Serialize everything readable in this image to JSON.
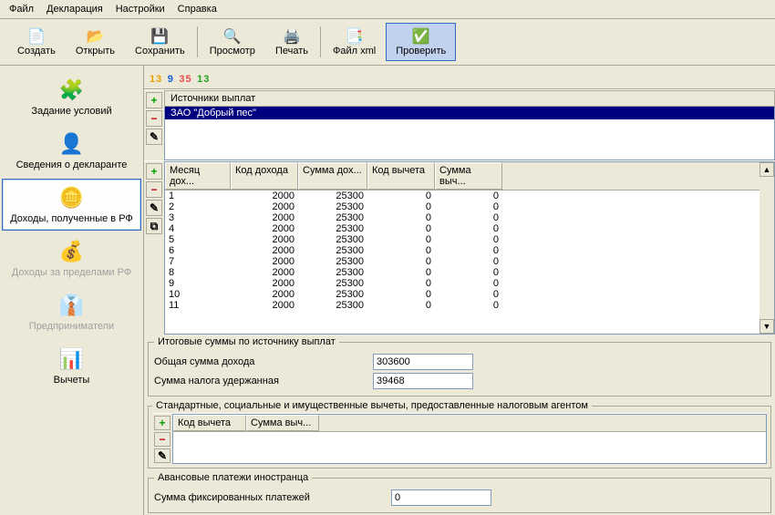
{
  "menu": {
    "file": "Файл",
    "decl": "Декларация",
    "settings": "Настройки",
    "help": "Справка"
  },
  "toolbar": {
    "create": "Создать",
    "open": "Открыть",
    "save": "Сохранить",
    "preview": "Просмотр",
    "print": "Печать",
    "xml": "Файл xml",
    "check": "Проверить"
  },
  "year": {
    "a": "13",
    "b": "9",
    "c": "35",
    "d": "13"
  },
  "sidebar": {
    "cond": "Задание условий",
    "declarant": "Сведения о декларанте",
    "incomeRf": "Доходы, полученные в РФ",
    "incomeAbroad": "Доходы за пределами РФ",
    "entrepreneur": "Предприниматели",
    "deductions": "Вычеты"
  },
  "sources": {
    "header": "Источники выплат",
    "items": [
      "ЗАО \"Добрый пес\""
    ]
  },
  "incomeTable": {
    "cols": [
      "Месяц дох...",
      "Код дохода",
      "Сумма дох...",
      "Код вычета",
      "Сумма выч..."
    ],
    "rows": [
      {
        "m": "1",
        "code": "2000",
        "sum": "25300",
        "dcode": "0",
        "dsum": "0"
      },
      {
        "m": "2",
        "code": "2000",
        "sum": "25300",
        "dcode": "0",
        "dsum": "0"
      },
      {
        "m": "3",
        "code": "2000",
        "sum": "25300",
        "dcode": "0",
        "dsum": "0"
      },
      {
        "m": "4",
        "code": "2000",
        "sum": "25300",
        "dcode": "0",
        "dsum": "0"
      },
      {
        "m": "5",
        "code": "2000",
        "sum": "25300",
        "dcode": "0",
        "dsum": "0"
      },
      {
        "m": "6",
        "code": "2000",
        "sum": "25300",
        "dcode": "0",
        "dsum": "0"
      },
      {
        "m": "7",
        "code": "2000",
        "sum": "25300",
        "dcode": "0",
        "dsum": "0"
      },
      {
        "m": "8",
        "code": "2000",
        "sum": "25300",
        "dcode": "0",
        "dsum": "0"
      },
      {
        "m": "9",
        "code": "2000",
        "sum": "25300",
        "dcode": "0",
        "dsum": "0"
      },
      {
        "m": "10",
        "code": "2000",
        "sum": "25300",
        "dcode": "0",
        "dsum": "0"
      },
      {
        "m": "11",
        "code": "2000",
        "sum": "25300",
        "dcode": "0",
        "dsum": "0"
      }
    ]
  },
  "totals": {
    "legend": "Итоговые суммы по источнику выплат",
    "incomeLabel": "Общая сумма дохода",
    "incomeValue": "303600",
    "taxLabel": "Сумма налога удержанная",
    "taxValue": "39468"
  },
  "deductionsBox": {
    "legend": "Стандартные, социальные и имущественные вычеты, предоставленные налоговым агентом",
    "cols": [
      "Код вычета",
      "Сумма выч..."
    ]
  },
  "advance": {
    "legend": "Авансовые платежи иностранца",
    "label": "Сумма фиксированных платежей",
    "value": "0"
  }
}
